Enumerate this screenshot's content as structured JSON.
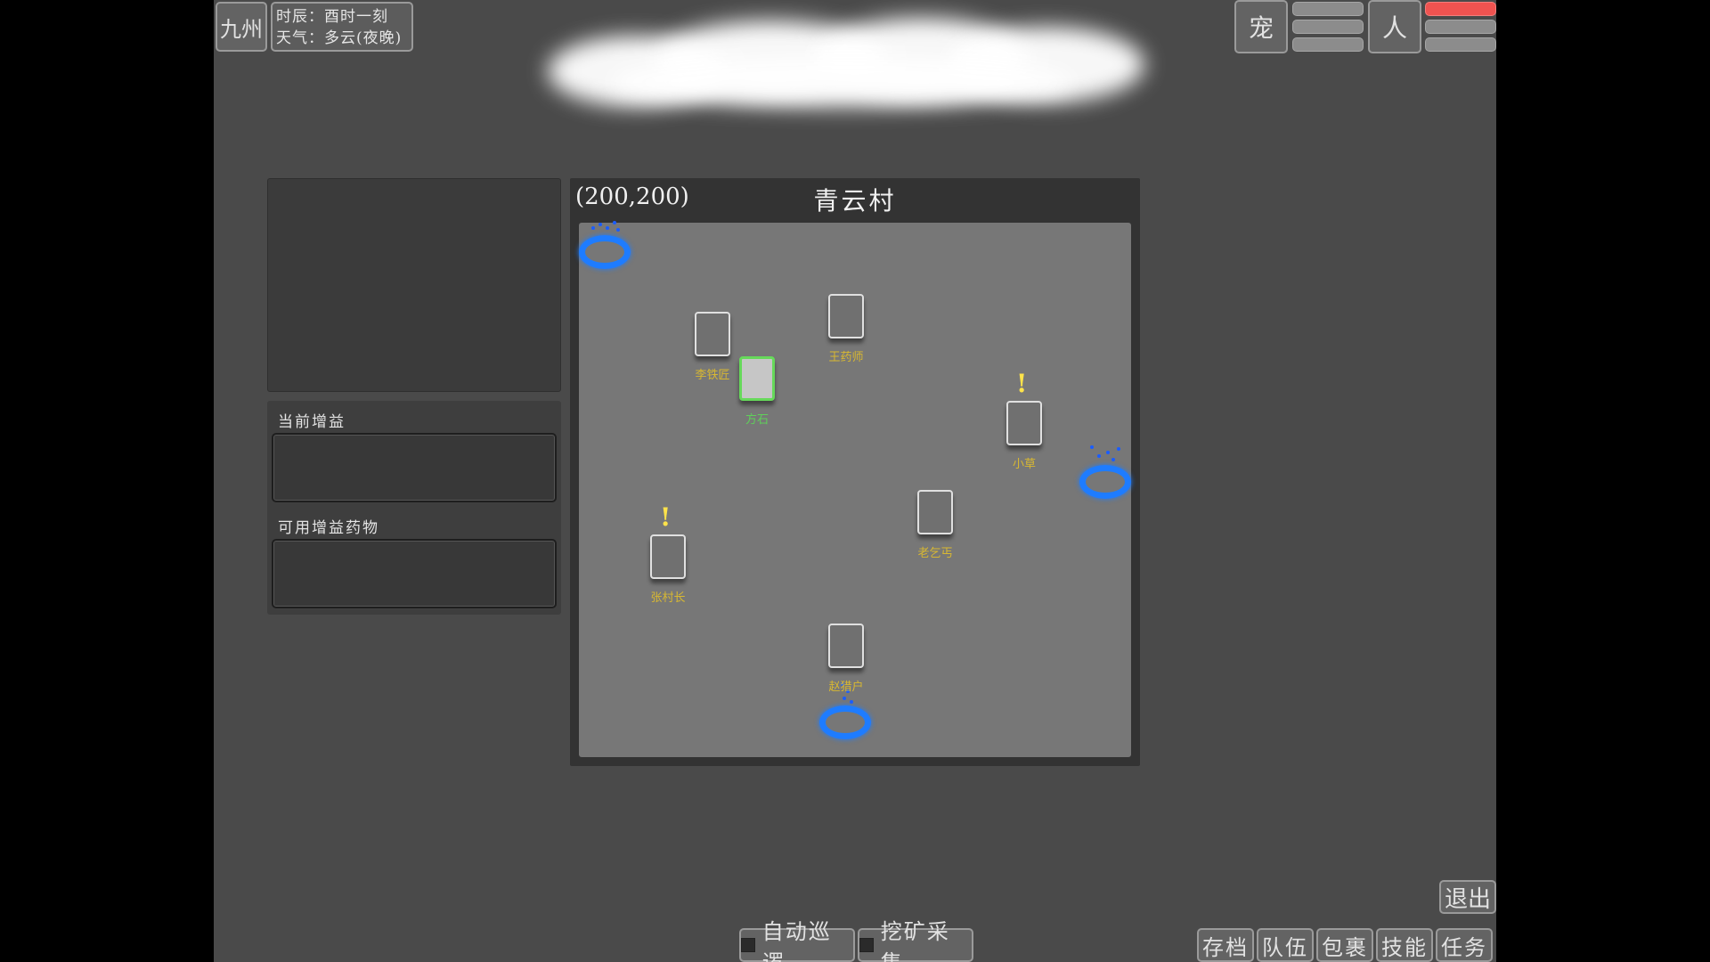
{
  "header": {
    "region_label": "九州",
    "time_text": "时辰：酉时一刻",
    "weather_text": "天气：多云(夜晚)",
    "pet_label": "宠",
    "person_label": "人"
  },
  "colors": {
    "health_bar": "#ef5350",
    "portal": "#1e7cff",
    "npc_name": "#d8b832",
    "player_name": "#5fcf5a",
    "quest_marker": "#ffe34a"
  },
  "left_panel": {
    "current_buff_label": "当前增益",
    "available_potion_label": "可用增益药物"
  },
  "map": {
    "coordinates": "(200,200)",
    "title": "青云村",
    "player": {
      "name": "方石"
    },
    "npcs": [
      {
        "name": "李铁匠",
        "quest": false
      },
      {
        "name": "王药师",
        "quest": false
      },
      {
        "name": "小草",
        "quest": true
      },
      {
        "name": "老乞丐",
        "quest": false
      },
      {
        "name": "张村长",
        "quest": true
      },
      {
        "name": "赵猎户",
        "quest": false
      }
    ]
  },
  "bottom": {
    "auto_patrol_label": "自动巡逻",
    "mining_label": "挖矿采集",
    "exit_label": "退出",
    "menu": [
      "存档",
      "队伍",
      "包裹",
      "技能",
      "任务"
    ]
  }
}
